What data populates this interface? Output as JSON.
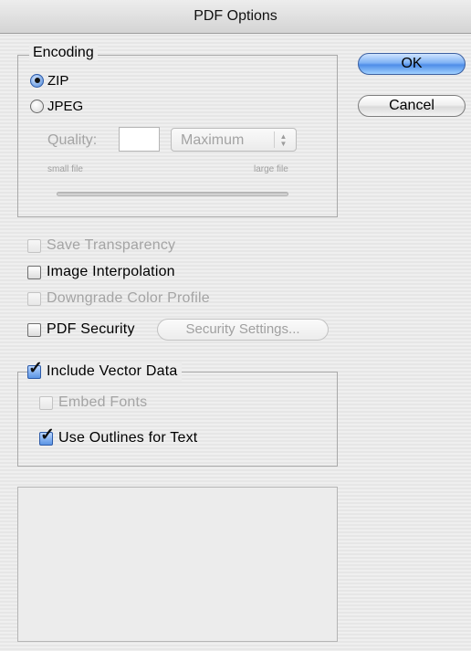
{
  "window": {
    "title": "PDF Options"
  },
  "encoding": {
    "legend": "Encoding",
    "zip_label": "ZIP",
    "jpeg_label": "JPEG",
    "selected": "ZIP",
    "quality_label": "Quality:",
    "quality_value": "",
    "quality_preset": "Maximum",
    "small_file_label": "small file",
    "large_file_label": "large file"
  },
  "options": {
    "save_transparency": {
      "label": "Save Transparency",
      "checked": false,
      "enabled": false
    },
    "image_interpolation": {
      "label": "Image Interpolation",
      "checked": false,
      "enabled": true
    },
    "downgrade_color_profile": {
      "label": "Downgrade Color Profile",
      "checked": false,
      "enabled": false
    },
    "pdf_security": {
      "label": "PDF Security",
      "checked": false,
      "enabled": true
    },
    "security_settings_button": "Security Settings..."
  },
  "vector": {
    "include_vector_data": {
      "label": "Include Vector Data",
      "checked": true
    },
    "embed_fonts": {
      "label": "Embed Fonts",
      "checked": false,
      "enabled": false
    },
    "use_outlines": {
      "label": "Use Outlines for Text",
      "checked": true
    }
  },
  "buttons": {
    "ok": "OK",
    "cancel": "Cancel"
  },
  "icons": {
    "radio_on": "radio-selected-icon",
    "checkmark": "checkmark-icon"
  }
}
